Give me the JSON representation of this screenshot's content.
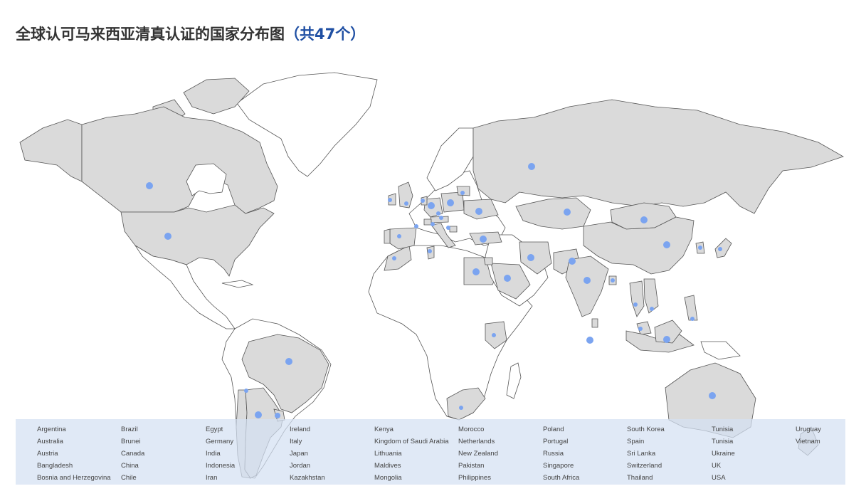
{
  "title": {
    "main": "全球认可马来西亚清真认证的国家分布图",
    "count": "（共47个）"
  },
  "colors": {
    "covered_land": "#dadada",
    "uncovered_land": "#ffffff",
    "marker": "#7ba4f0",
    "title_accent": "#1f4fa3",
    "legend_background": "#d4e0f3"
  },
  "legend": {
    "columns": [
      [
        "Argentina",
        "Australia",
        "Austria",
        "Bangladesh",
        "Bosnia and Herzegovina"
      ],
      [
        "Brazil",
        "Brunei",
        "Canada",
        "China",
        "Chile"
      ],
      [
        "Egypt",
        "Germany",
        "India",
        "Indonesia",
        "Iran"
      ],
      [
        "Ireland",
        "Italy",
        "Japan",
        "Jordan",
        "Kazakhstan"
      ],
      [
        "Kenya",
        "Kingdom of Saudi Arabia",
        "Lithuania",
        "Maldives",
        "Mongolia"
      ],
      [
        "Morocco",
        "Netherlands",
        "New Zealand",
        "Pakistan",
        "Philippines"
      ],
      [
        "Poland",
        "Portugal",
        "Russia",
        "Singapore",
        "South Africa"
      ],
      [
        "South Korea",
        "Spain",
        "Sri Lanka",
        "Switzerland",
        "Thailand"
      ],
      [
        "Tunisia",
        "Tunisia",
        "Ukraine",
        "UK",
        "USA"
      ],
      [
        "Uruguay",
        "Vietnam"
      ]
    ]
  }
}
